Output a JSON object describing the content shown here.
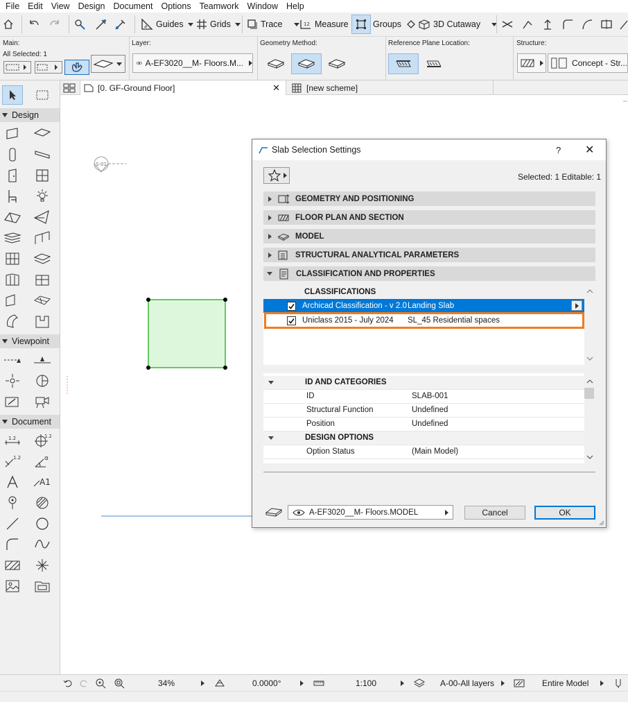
{
  "menu": [
    "File",
    "Edit",
    "View",
    "Design",
    "Document",
    "Options",
    "Teamwork",
    "Window",
    "Help"
  ],
  "toolbar": {
    "guides": "Guides",
    "grids": "Grids",
    "trace": "Trace",
    "measure": "Measure",
    "groups": "Groups",
    "cutaway": "3D Cutaway"
  },
  "infobox": {
    "main_label": "Main:",
    "all_selected": "All Selected: 1",
    "layer_label": "Layer:",
    "layer_value": "A-EF3020__M- Floors.M...",
    "geometry_label": "Geometry Method:",
    "refplane_label": "Reference Plane Location:",
    "structure_label": "Structure:",
    "structure_value": "Concept - Str..."
  },
  "toolbox": {
    "design": "Design",
    "viewpoint": "Viewpoint",
    "document": "Document"
  },
  "tabs": [
    {
      "label": "[0. GF-Ground Floor]"
    },
    {
      "label": "[new scheme]"
    }
  ],
  "canvas": {
    "marker": "S-01"
  },
  "status": {
    "zoom": "34%",
    "angle": "0.0000°",
    "scale": "1:100",
    "layers": "A-00-All layers",
    "model": "Entire Model"
  },
  "dialog": {
    "title": "Slab Selection Settings",
    "help": "?",
    "selected_info": "Selected: 1 Editable: 1",
    "panels": [
      "GEOMETRY AND POSITIONING",
      "FLOOR PLAN AND SECTION",
      "MODEL",
      "STRUCTURAL ANALYTICAL PARAMETERS",
      "CLASSIFICATION AND PROPERTIES"
    ],
    "classifications_header": "CLASSIFICATIONS",
    "classifications": [
      {
        "system": "Archicad Classification - v 2.0",
        "value": "Landing Slab",
        "checked": true
      },
      {
        "system": "Uniclass 2015 - July 2024",
        "value": "SL_45 Residential spaces",
        "checked": true
      }
    ],
    "id_group": "ID AND CATEGORIES",
    "id_rows": [
      {
        "name": "ID",
        "value": "SLAB-001"
      },
      {
        "name": "Structural Function",
        "value": "Undefined"
      },
      {
        "name": "Position",
        "value": "Undefined"
      }
    ],
    "design_group": "DESIGN OPTIONS",
    "design_rows": [
      {
        "name": "Option Status",
        "value": "(Main Model)"
      }
    ],
    "layer_value": "A-EF3020__M- Floors.MODEL",
    "cancel": "Cancel",
    "ok": "OK"
  },
  "colors": {
    "selection_blue": "#0078d7",
    "highlight_orange": "#f07c1e",
    "slab_fill": "#dcf7dc",
    "slab_stroke": "#38b838"
  }
}
